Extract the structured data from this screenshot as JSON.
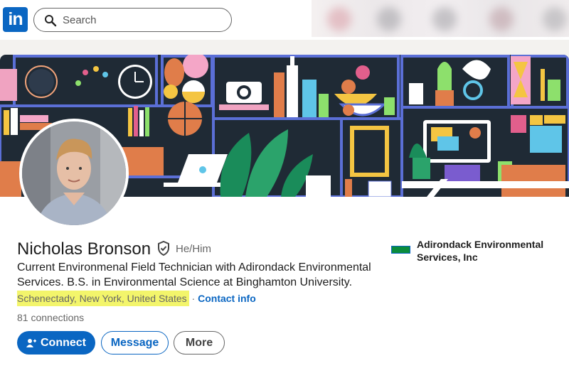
{
  "app": {
    "logo_text": "in"
  },
  "search": {
    "placeholder": "Search"
  },
  "profile": {
    "name": "Nicholas Bronson",
    "pronouns": "He/Him",
    "headline": "Current Environmenal Field Technician with Adirondack Environmental Services. B.S. in Environmental Science at Binghamton University.",
    "location": "Schenectady, New York, United States",
    "separator": "·",
    "contact_label": "Contact info",
    "connections": "81 connections"
  },
  "actions": {
    "connect_label": "Connect",
    "message_label": "Message",
    "more_label": "More"
  },
  "company": {
    "name": "Adirondack Environmental Services, Inc"
  },
  "colors": {
    "brand": "#0a66c2",
    "highlight": "#f3f56b",
    "banner_bg": "#1f2a35"
  },
  "icons": [
    "linkedin-logo-icon",
    "search-icon",
    "verified-shield-icon",
    "connect-person-plus-icon",
    "company-logo-icon"
  ]
}
